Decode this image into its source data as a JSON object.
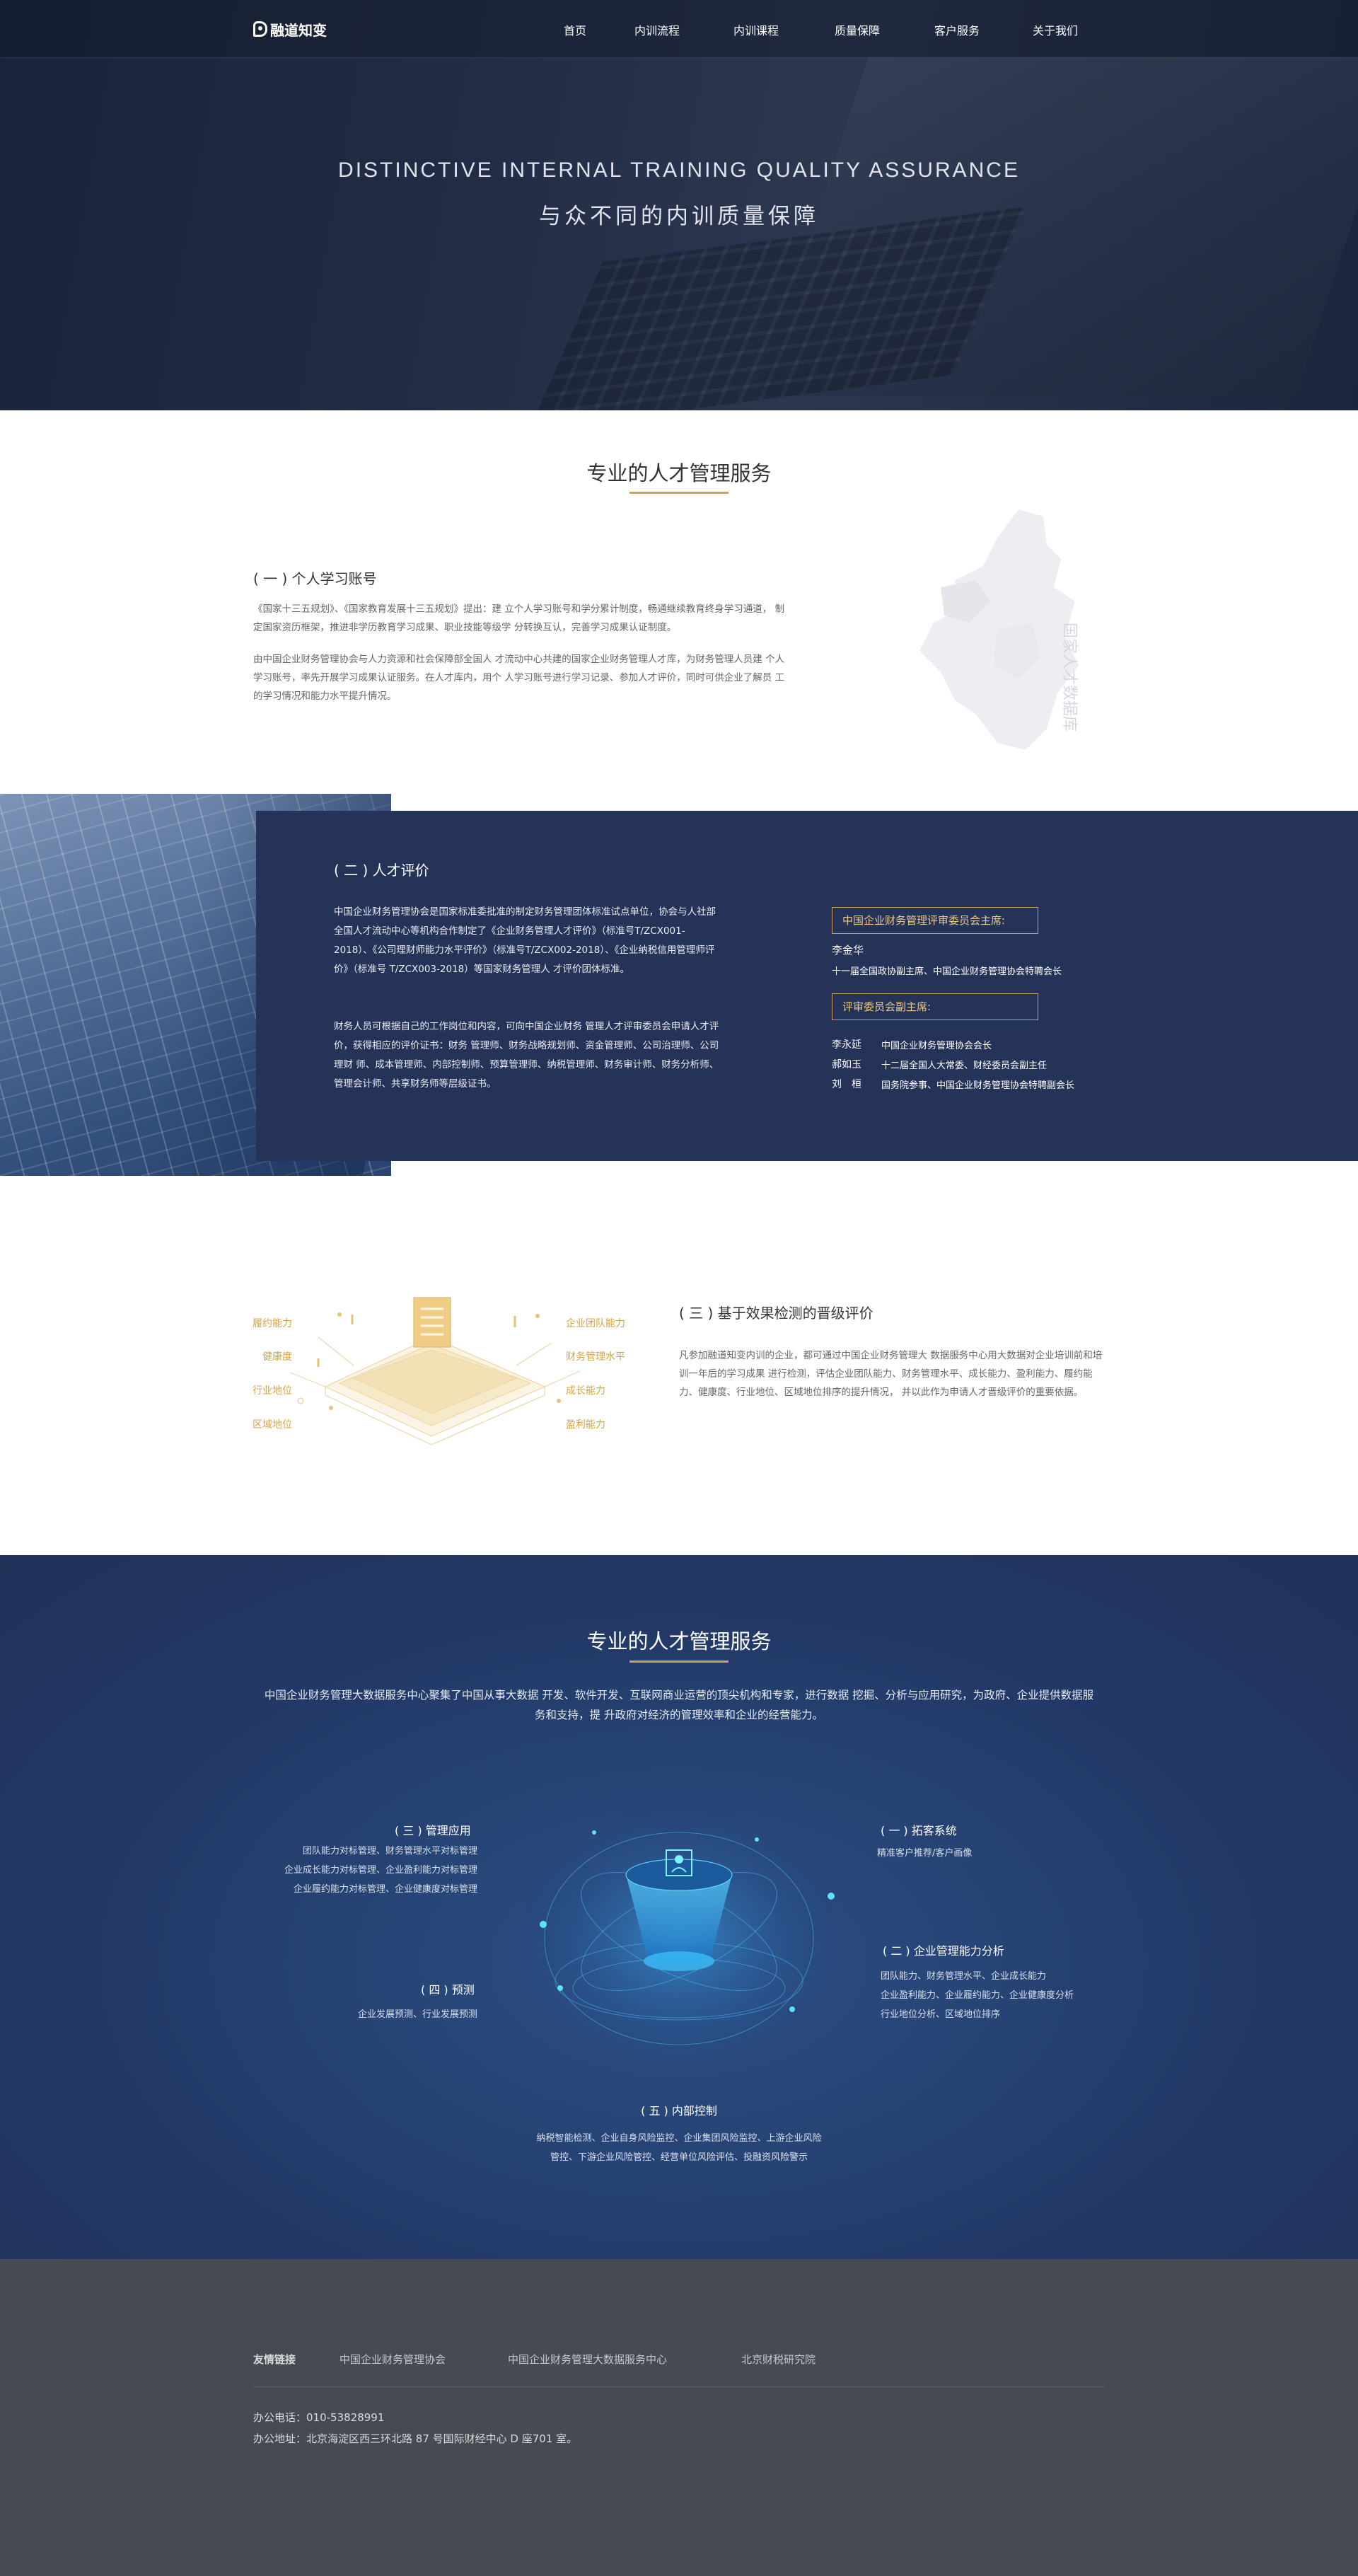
{
  "brand": {
    "name": "融道知变"
  },
  "nav": {
    "items": [
      "首页",
      "内训流程",
      "内训课程",
      "质量保障",
      "客户服务",
      "关于我们"
    ]
  },
  "hero": {
    "title_en": "DISTINCTIVE INTERNAL TRAINING QUALITY ASSURANCE",
    "title_cn": "与众不同的内训质量保障"
  },
  "section1": {
    "title": "专业的人才管理服务",
    "subtitle": "( 一 ) 个人学习账号",
    "para1": "《国家十三五规划》、《国家教育发展十三五规划》提出：建 立个人学习账号和学分累计制度，畅通继续教育终身学习通道， 制定国家资历框架，推进非学历教育学习成果、职业技能等级学 分转换互认，完善学习成果认证制度。",
    "para2": "由中国企业财务管理协会与人力资源和社会保障部全国人 才流动中心共建的国家企业财务管理人才库，为财务管理人员建 个人学习账号，率先开展学习成果认证服务。在人才库内，用个 人学习账号进行学习记录、参加人才评价，同时可供企业了解员 工的学习情况和能力水平提升情况。",
    "map_text": "国家人才数据库"
  },
  "section2": {
    "subtitle": "( 二 ) 人才评价",
    "para1": "中国企业财务管理协会是国家标准委批准的制定财务管理团体标准试点单位，协会与人社部全国人才流动中心等机构合作制定了《企业财务管理人才评价》（标准号T/ZCX001-2018）、《公司理财师能力水平评价》（标准号T/ZCX002-2018）、《企业纳税信用管理师评价》（标准号 T/ZCX003-2018）等国家财务管理人 才评价团体标准。",
    "para2": "财务人员可根据自己的工作岗位和内容，可向中国企业财务 管理人才评审委员会申请人才评价，获得相应的评价证书：财务 管理师、财务战略规划师、资金管理师、公司治理师、公司理财 师、成本管理师、内部控制师、预算管理师、纳税管理师、财务审计师、财务分析师、管理会计师、共享财务师等层级证书。",
    "chair_box": "中国企业财务管理评审委员会主席:",
    "chair_name": "李金华",
    "chair_desc": "十一届全国政协副主席、中国企业财务管理协会特聘会长",
    "vice_box": "评审委员会副主席:",
    "vice": [
      {
        "name": "李永延",
        "desc": "中国企业财务管理协会会长"
      },
      {
        "name": "郝如玉",
        "desc": "十二届全国人大常委、财经委员会副主任"
      },
      {
        "name": "刘　桓",
        "desc": "国务院参事、中国企业财务管理协会特聘副会长"
      }
    ]
  },
  "section3": {
    "subtitle": "( 三 ) 基于效果检测的晋级评价",
    "para": "凡参加融道知变内训的企业，都可通过中国企业财务管理大 数据服务中心用大数据对企业培训前和培训一年后的学习成果 进行检测，评估企业团队能力、财务管理水平、成长能力、盈利能力、履约能力、健康度、行业地位、区域地位排序的提升情况， 并以此作为申请人才晋级评价的重要依据。",
    "left_labels": [
      "履约能力",
      "健康度",
      "行业地位",
      "区域地位"
    ],
    "right_labels": [
      "企业团队能力",
      "财务管理水平",
      "成长能力",
      "盈利能力"
    ]
  },
  "section4": {
    "title": "专业的人才管理服务",
    "intro": "中国企业财务管理大数据服务中心聚集了中国从事大数据 开发、软件开发、互联网商业运营的顶尖机构和专家，进行数据 挖掘、分析与应用研究，为政府、企业提供数据服务和支持，提 升政府对经济的管理效率和企业的经营能力。",
    "blocks": {
      "mgmt_app": {
        "title": "( 三 ) 管理应用",
        "lines": [
          "团队能力对标管理、财务管理水平对标管理",
          "企业成长能力对标管理、企业盈利能力对标管理",
          "企业履约能力对标管理、企业健康度对标管理"
        ]
      },
      "forecast": {
        "title": "( 四 ) 预测",
        "lines": [
          "企业发展预测、行业发展预测"
        ]
      },
      "expand": {
        "title": "( 一 ) 拓客系统",
        "lines": [
          "精准客户推荐/客户画像"
        ]
      },
      "analysis": {
        "title": "( 二 ) 企业管理能力分析",
        "lines": [
          "团队能力、财务管理水平、企业成长能力",
          "企业盈利能力、企业履约能力、企业健康度分析",
          "行业地位分析、区域地位排序"
        ]
      },
      "control": {
        "title": "( 五 ) 内部控制",
        "lines": [
          "纳税智能检测、企业自身风险监控、企业集团风险监控、上游企业风险",
          "管控、下游企业风险管控、经营单位风险评估、投融资风险警示"
        ]
      }
    }
  },
  "footer": {
    "links_label": "友情链接",
    "links": [
      "中国企业财务管理协会",
      "中国企业财务管理大数据服务中心",
      "北京财税研究院"
    ],
    "phone": "办公电话：010-53828991",
    "address": "办公地址：北京海淀区西三环北路 87 号国际财经中心 D 座701 室。"
  },
  "colors": {
    "accent_gold": "#c9a35a",
    "panel_navy": "#263358",
    "footer_gray": "#464a52"
  }
}
